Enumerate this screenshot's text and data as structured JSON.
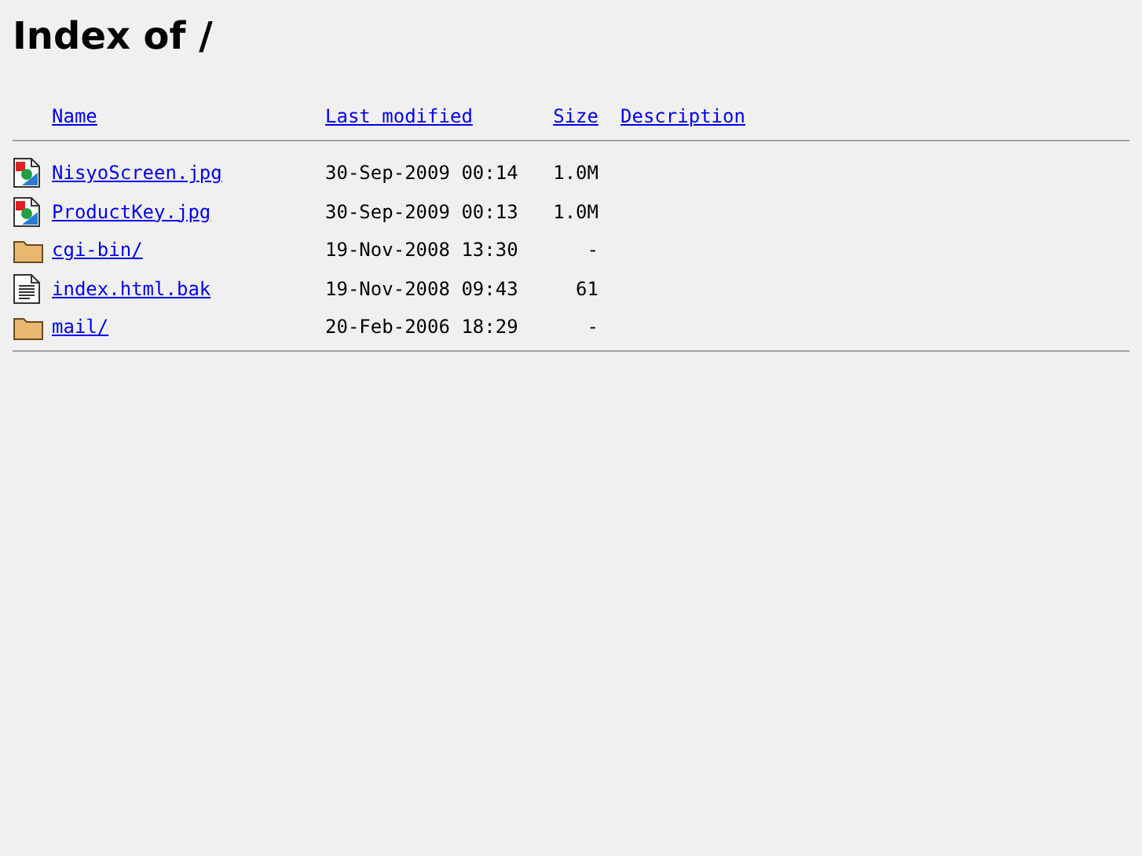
{
  "title": "Index of /",
  "columns": [
    "Name",
    "Last modified",
    "Size",
    "Description"
  ],
  "rows": [
    {
      "kind": "image",
      "name": "NisyoScreen.jpg",
      "modified": "30-Sep-2009 00:14",
      "size": "1.0M"
    },
    {
      "kind": "image",
      "name": "ProductKey.jpg",
      "modified": "30-Sep-2009 00:13",
      "size": "1.0M"
    },
    {
      "kind": "folder",
      "name": "cgi-bin/",
      "modified": "19-Nov-2008 13:30",
      "size": "-"
    },
    {
      "kind": "text",
      "name": "index.html.bak",
      "modified": "19-Nov-2008 09:43",
      "size": "61"
    },
    {
      "kind": "folder",
      "name": "mail/",
      "modified": "20-Feb-2006 18:29",
      "size": "-"
    }
  ]
}
